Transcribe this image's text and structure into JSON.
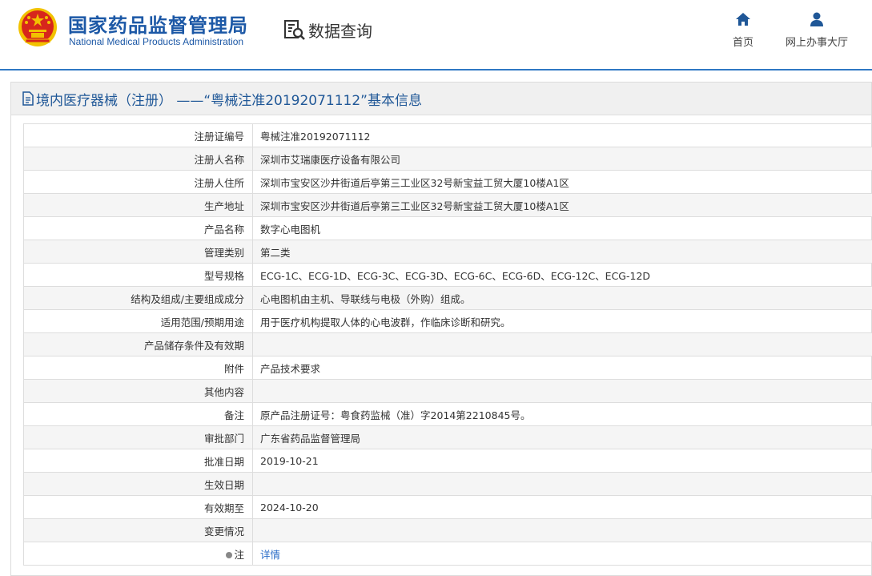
{
  "header": {
    "brand_cn": "国家药品监督管理局",
    "brand_en": "National Medical Products Administration",
    "query_label": "数据查询",
    "nav": [
      {
        "label": "首页",
        "icon": "home-icon"
      },
      {
        "label": "网上办事大厅",
        "icon": "user-icon"
      }
    ]
  },
  "panel": {
    "title": "境内医疗器械（注册） ——“粤械注准20192071112”基本信息",
    "title_icon": "document-icon"
  },
  "table": {
    "rows": [
      {
        "label": "注册证编号",
        "value": "粤械注准20192071112"
      },
      {
        "label": "注册人名称",
        "value": "深圳市艾瑞康医疗设备有限公司"
      },
      {
        "label": "注册人住所",
        "value": "深圳市宝安区沙井街道后亭第三工业区32号新宝益工贸大厦10楼A1区"
      },
      {
        "label": "生产地址",
        "value": "深圳市宝安区沙井街道后亭第三工业区32号新宝益工贸大厦10楼A1区"
      },
      {
        "label": "产品名称",
        "value": "数字心电图机"
      },
      {
        "label": "管理类别",
        "value": "第二类"
      },
      {
        "label": "型号规格",
        "value": "ECG-1C、ECG-1D、ECG-3C、ECG-3D、ECG-6C、ECG-6D、ECG-12C、ECG-12D"
      },
      {
        "label": "结构及组成/主要组成成分",
        "value": "心电图机由主机、导联线与电极（外购）组成。"
      },
      {
        "label": "适用范围/预期用途",
        "value": "用于医疗机构提取人体的心电波群，作临床诊断和研究。"
      },
      {
        "label": "产品储存条件及有效期",
        "value": ""
      },
      {
        "label": "附件",
        "value": "产品技术要求"
      },
      {
        "label": "其他内容",
        "value": ""
      },
      {
        "label": "备注",
        "value": "原产品注册证号：粤食药监械（准）字2014第2210845号。"
      },
      {
        "label": "审批部门",
        "value": "广东省药品监督管理局"
      },
      {
        "label": "批准日期",
        "value": "2019-10-21"
      },
      {
        "label": "生效日期",
        "value": ""
      },
      {
        "label": "有效期至",
        "value": "2024-10-20"
      },
      {
        "label": "变更情况",
        "value": ""
      }
    ],
    "note_row": {
      "label": "注",
      "link": "详情"
    }
  },
  "colors": {
    "brand_blue": "#1c58a6",
    "title_blue": "#1f5797",
    "link_blue": "#2a6cc7",
    "emblem_red": "#d7261c",
    "emblem_gold": "#f2c200"
  }
}
